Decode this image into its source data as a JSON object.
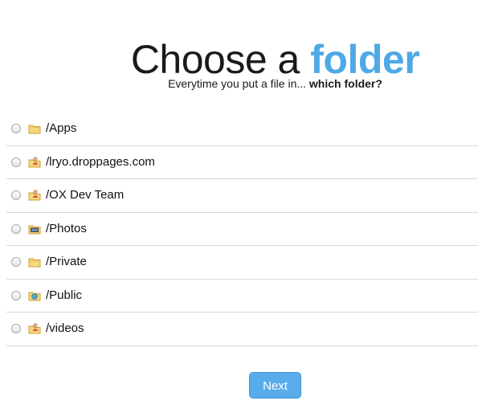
{
  "header": {
    "title_plain": "Choose a ",
    "title_accent": "folder",
    "subtitle_plain": "Everytime you put a file in... ",
    "subtitle_bold": "which folder?"
  },
  "folders": [
    {
      "label": "/Apps",
      "icon": "folder-icon"
    },
    {
      "label": "/lryo.droppages.com",
      "icon": "shared-folder-icon"
    },
    {
      "label": "/OX Dev Team",
      "icon": "shared-folder-icon"
    },
    {
      "label": "/Photos",
      "icon": "photos-folder-icon"
    },
    {
      "label": "/Private",
      "icon": "folder-icon"
    },
    {
      "label": "/Public",
      "icon": "public-folder-icon"
    },
    {
      "label": "/videos",
      "icon": "shared-folder-icon"
    }
  ],
  "actions": {
    "next_label": "Next"
  },
  "colors": {
    "accent": "#4ea9e6",
    "button": "#58acec"
  }
}
